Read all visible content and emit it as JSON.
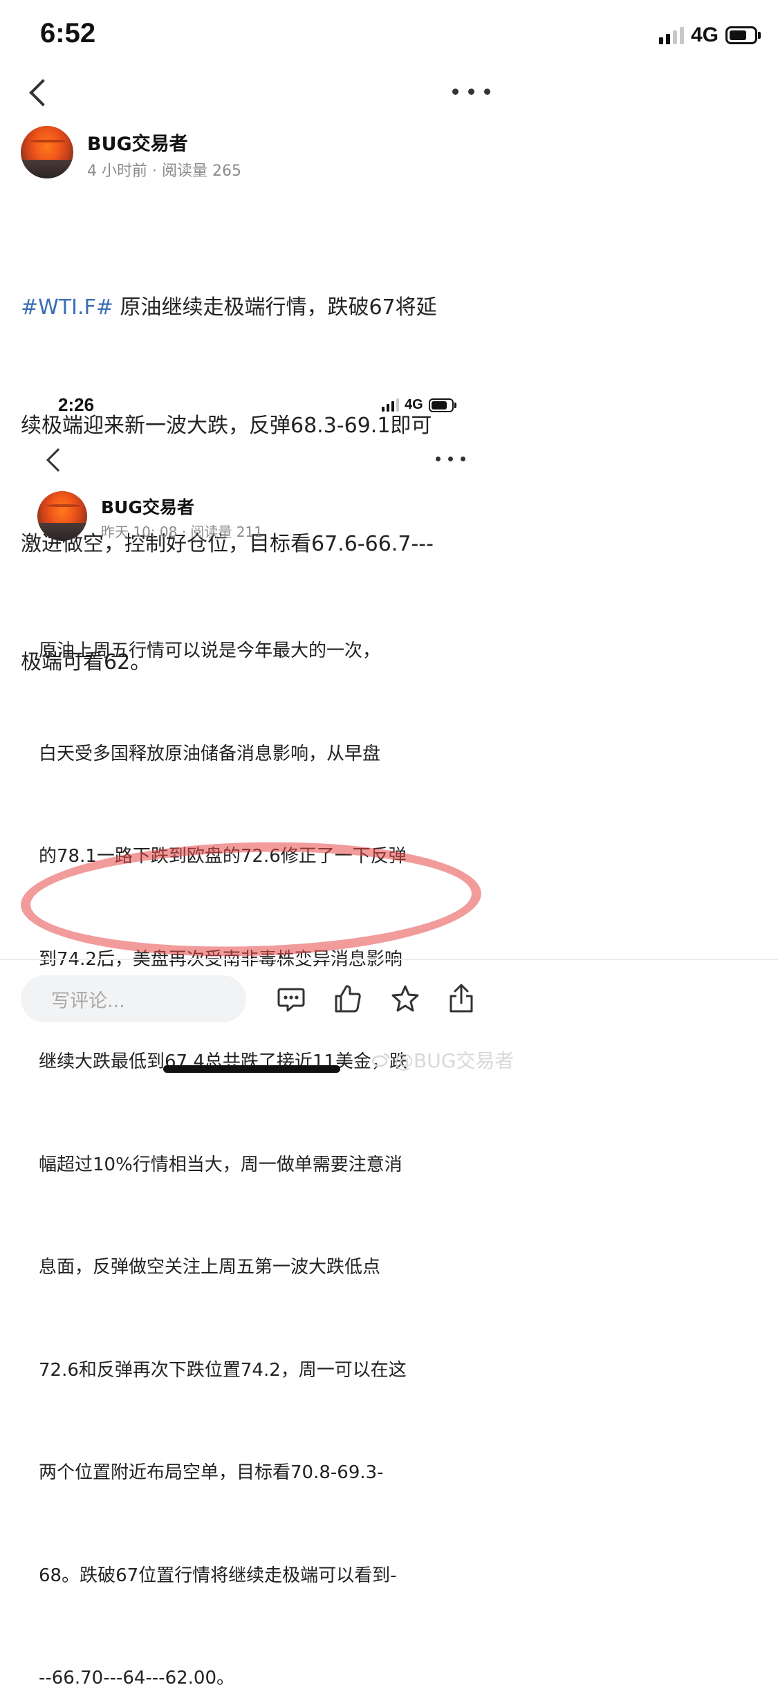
{
  "top": {
    "status": {
      "time": "6:52",
      "network": "4G"
    },
    "author": "BUG交易者",
    "meta": "4 小时前 · 阅读量 265",
    "hashtag": "#WTI.F#",
    "lines": [
      " 原油继续走极端行情，跌破67将延",
      "续极端迎来新一波大跌，反弹68.3-69.1即可",
      "激进做空，控制好仓位，目标看67.6-66.7---",
      "极端可看62。"
    ]
  },
  "embedded": {
    "status": {
      "time": "2:26",
      "network": "4G"
    },
    "author": "BUG交易者",
    "meta": "昨天 10: 08 · 阅读量 211",
    "lines": [
      "原油上周五行情可以说是今年最大的一次，",
      "白天受多国释放原油储备消息影响，从早盘",
      "的78.1一路下跌到欧盘的72.6修正了一下反弹",
      "到74.2后，美盘再次受南非毒株变异消息影响",
      "继续大跌最低到67.4总共跌了接近11美金，跌",
      "幅超过10%行情相当大，周一做单需要注意消",
      "息面，反弹做空关注上周五第一波大跌低点",
      "72.6和反弹再次下跌位置74.2，周一可以在这",
      "两个位置附近布局空单，目标看70.8-69.3-",
      "68。跌破67位置行情将继续走极端可以看到-",
      "--66.70---64---62.00。"
    ]
  },
  "bottom_bar": {
    "comment_placeholder": "写评论...",
    "icons": [
      "comment-icon",
      "like-icon",
      "star-icon",
      "share-icon"
    ]
  },
  "watermark": "@BUG交易者",
  "colors": {
    "hashtag": "#3a6fb6",
    "highlight_ring": "#e84848",
    "meta": "#8c8c8c"
  }
}
